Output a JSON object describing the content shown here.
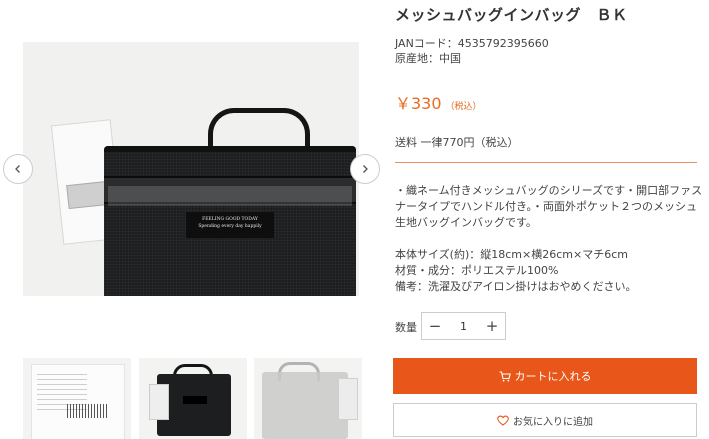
{
  "product": {
    "title": "メッシュバッグインバッグ　ＢＫ",
    "jan": "JANコード：4535792395660",
    "origin": "原産地：中国",
    "price": "￥330",
    "price_tax": "（税込）",
    "shipping": "送料 一律770円（税込）",
    "description": "・織ネーム付きメッシュバッグのシリーズです・開口部ファスナータイプでハンドル付き。・両面外ポケット２つのメッシュ生地バッグインバッグです。",
    "specs": [
      "本体サイズ(約)：縦18cm×横26cm×マチ6cm",
      "材質・成分：ポリエステル100%",
      "備考：洗濯及びアイロン掛けはおやめください。"
    ]
  },
  "image": {
    "label_text_1": "FEELING GOOD TODAY",
    "label_text_2": "Spending every day happily"
  },
  "quantity": {
    "label": "数量",
    "minus": "−",
    "plus": "+",
    "value": "1"
  },
  "buttons": {
    "cart": "カートに入れる",
    "favorite": "お気に入りに追加"
  },
  "icons": {
    "prev": "chevron-left-icon",
    "next": "chevron-right-icon",
    "cart": "cart-icon",
    "heart": "heart-icon"
  },
  "colors": {
    "accent": "#e8561a",
    "price": "#e86b1f"
  }
}
